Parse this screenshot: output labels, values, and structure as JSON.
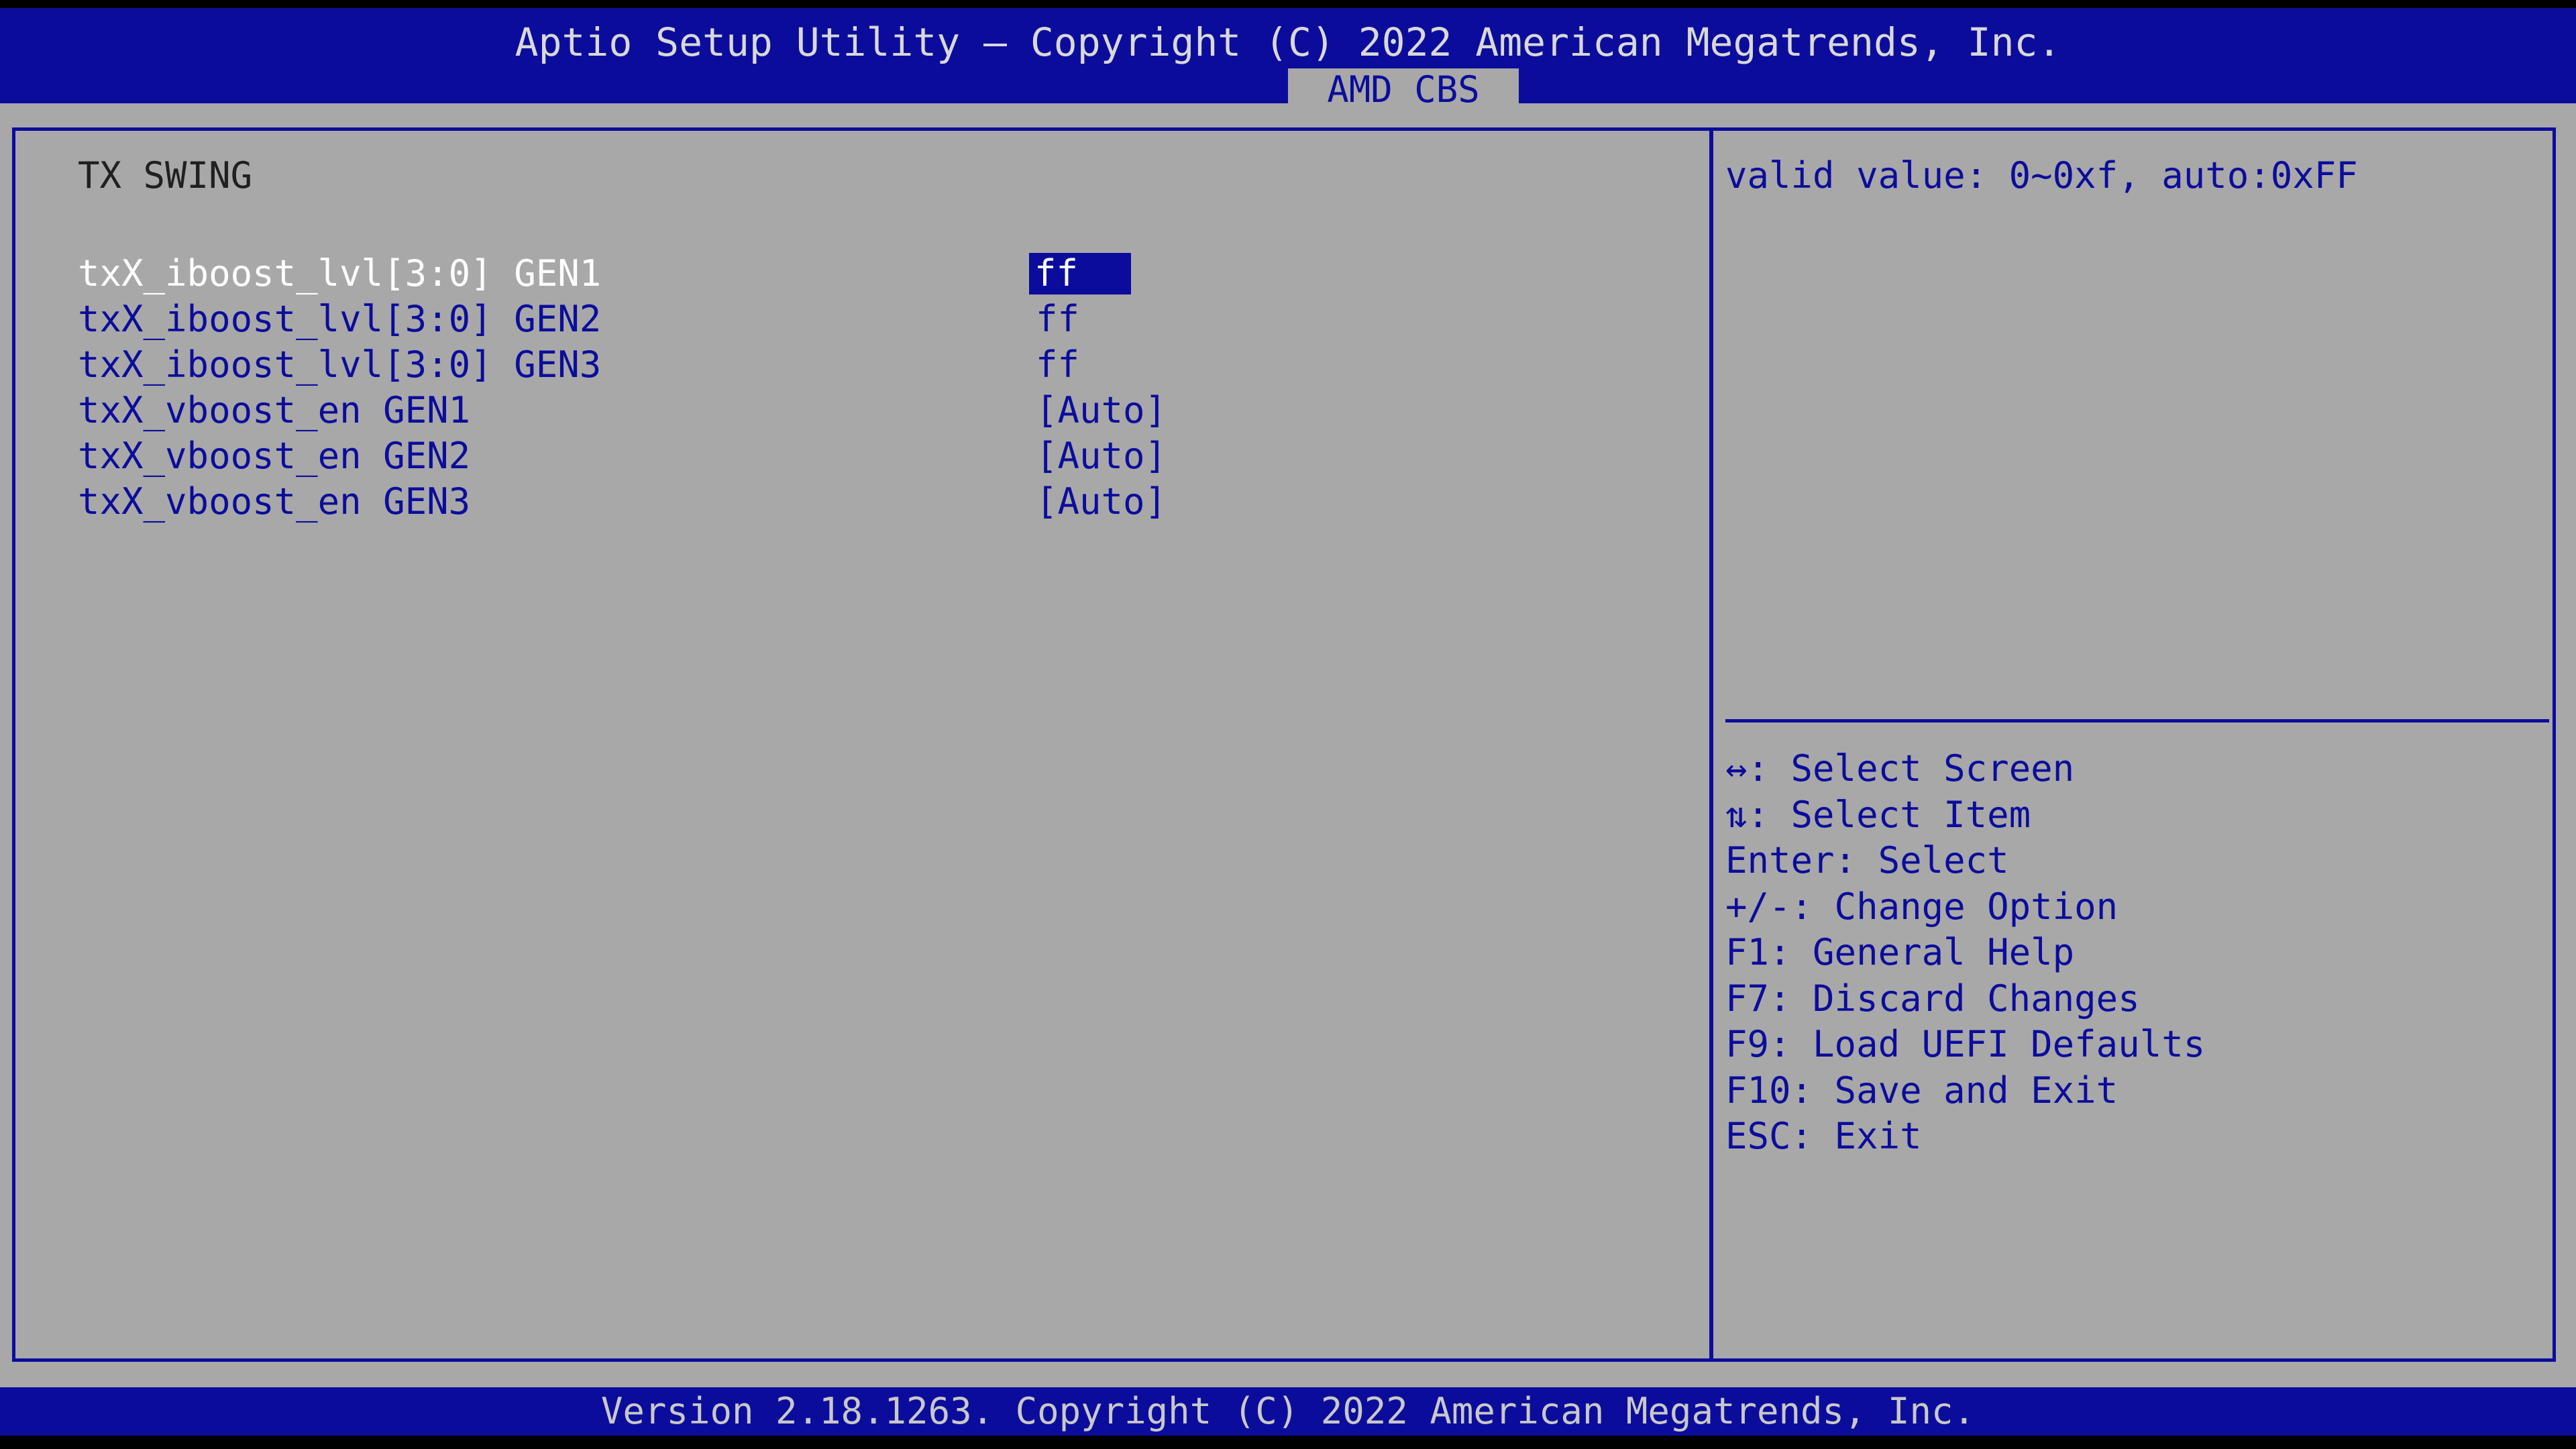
{
  "header": {
    "title": "Aptio Setup Utility – Copyright (C) 2022 American Megatrends, Inc.",
    "active_tab": "AMD CBS"
  },
  "main": {
    "section_title": "TX SWING",
    "settings": [
      {
        "label": "txX_iboost_lvl[3:0] GEN1",
        "value": "ff"
      },
      {
        "label": "txX_iboost_lvl[3:0] GEN2",
        "value": "ff"
      },
      {
        "label": "txX_iboost_lvl[3:0] GEN3",
        "value": "ff"
      },
      {
        "label": "txX_vboost_en GEN1",
        "value": "[Auto]"
      },
      {
        "label": "txX_vboost_en GEN2",
        "value": "[Auto]"
      },
      {
        "label": "txX_vboost_en GEN3",
        "value": "[Auto]"
      }
    ]
  },
  "help": {
    "text": "valid value: 0~0xf, auto:0xFF",
    "keys": [
      "↔: Select Screen",
      "⇅: Select Item",
      "Enter: Select",
      "+/-: Change Option",
      "F1: General Help",
      "F7: Discard Changes",
      "F9: Load UEFI Defaults",
      "F10: Save and Exit",
      "ESC: Exit"
    ]
  },
  "footer": {
    "version": "Version 2.18.1263. Copyright (C) 2022 American Megatrends, Inc."
  },
  "colors": {
    "bar_blue": "#0c0c9c",
    "panel_gray": "#a8a8a8",
    "selected_text": "#ffffff"
  }
}
